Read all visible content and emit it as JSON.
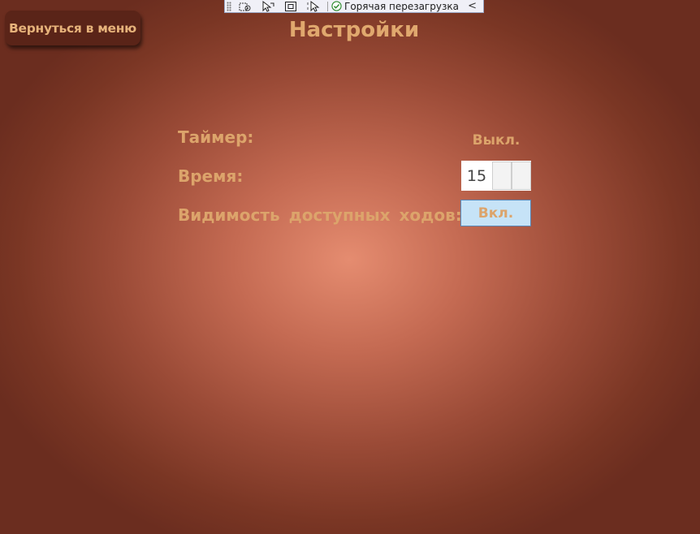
{
  "toolbar": {
    "icons": [
      "select-element-icon",
      "display-layout-adorners-icon",
      "track-focus-icon",
      "preview-selection-icon"
    ],
    "hot_reload_label": "Горячая перезагрузка",
    "hot_reload_status": "success",
    "collapse_glyph": "<"
  },
  "back_button": {
    "label": "Вернуться в меню"
  },
  "title": "Настройки",
  "settings": {
    "timer": {
      "label": "Таймер:",
      "value": "Выкл."
    },
    "time": {
      "label": "Время:",
      "value": "15"
    },
    "moves_visibility": {
      "label": "Видимость доступных ходов:",
      "value": "Вкл."
    }
  },
  "colors": {
    "accent_text": "#dca46b",
    "button_bg": "#5a2418",
    "toggle_on_bg": "#c6e3f7",
    "background_center": "#e58c70",
    "background_edge": "#6b2d1f"
  }
}
